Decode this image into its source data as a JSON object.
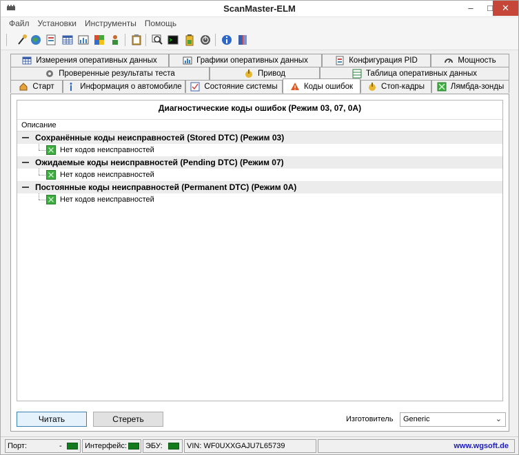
{
  "window": {
    "title": "ScanMaster-ELM"
  },
  "menu": [
    "Файл",
    "Установки",
    "Инструменты",
    "Помощь"
  ],
  "toolbar": {
    "icons": [
      "plug-icon",
      "globe-icon",
      "document-icon",
      "table-icon",
      "chart-icon",
      "flag-icon",
      "person-icon",
      "clipboard-icon",
      "search-icon",
      "terminal-icon",
      "battery-icon",
      "power-icon",
      "info-icon",
      "book-icon"
    ]
  },
  "tabs": {
    "row1": [
      {
        "label": "Измерения оперативных данных",
        "icon": "table-icon"
      },
      {
        "label": "Графики оперативных данных",
        "icon": "chart-icon"
      },
      {
        "label": "Конфигурация PID",
        "icon": "config-icon"
      },
      {
        "label": "Мощность",
        "icon": "gauge-icon"
      }
    ],
    "row2": [
      {
        "label": "Проверенные результаты теста",
        "icon": "gear-icon"
      },
      {
        "label": "Привод",
        "icon": "actuator-icon"
      },
      {
        "label": "Таблица оперативных данных",
        "icon": "grid-icon"
      }
    ],
    "row3": [
      {
        "label": "Старт",
        "icon": "home-icon"
      },
      {
        "label": "Информация о автомобиле",
        "icon": "info-icon"
      },
      {
        "label": "Состояние системы",
        "icon": "checklist-icon"
      },
      {
        "label": "Коды ошибок",
        "icon": "warning-icon"
      },
      {
        "label": "Стоп-кадры",
        "icon": "freeze-icon"
      },
      {
        "label": "Лямбда-зонды",
        "icon": "sensor-icon"
      }
    ]
  },
  "panel": {
    "title": "Диагностические коды ошибок (Режим 03, 07, 0A)",
    "column": "Описание",
    "groups": [
      {
        "label": "Сохранённые коды неисправностей (Stored DTC) (Режим 03)",
        "items": [
          "Нет кодов неисправностей"
        ]
      },
      {
        "label": "Ожидаемые коды неисправностей (Pending DTC) (Режим 07)",
        "items": [
          "Нет кодов неисправностей"
        ]
      },
      {
        "label": "Постоянные коды неисправностей (Permanent DTC) (Режим 0A)",
        "items": [
          "Нет кодов неисправностей"
        ]
      }
    ]
  },
  "actions": {
    "read": "Читать",
    "clear": "Стереть",
    "manufacturer_label": "Изготовитель",
    "manufacturer_value": "Generic"
  },
  "status": {
    "port_label": "Порт:",
    "port_value": "-",
    "interface_label": "Интерфейс:",
    "ecu_label": "ЭБУ:",
    "vin": "VIN: WF0UXXGAJU7L65739",
    "website": "www.wgsoft.de",
    "led_color": "#157a1d"
  }
}
